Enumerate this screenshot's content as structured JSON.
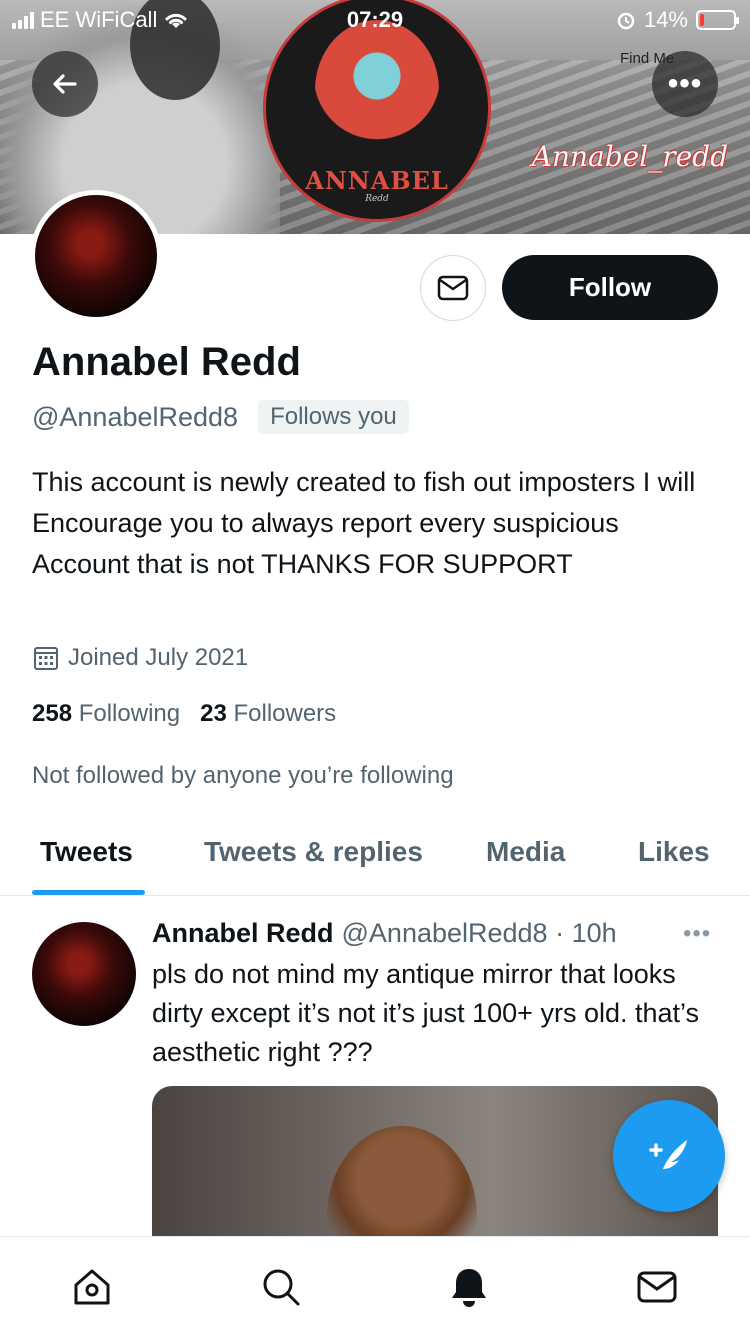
{
  "status_bar": {
    "carrier": "EE WiFiCall",
    "time": "07:29",
    "battery_percent": "14%",
    "battery_level": 0.14,
    "icons": [
      "signal-icon",
      "wifi-icon",
      "alarm-icon",
      "battery-icon"
    ]
  },
  "banner": {
    "logo_text": "ANNABEL",
    "logo_sub": "Redd",
    "script_text": "Annabel_redd",
    "find_me": "Find Me"
  },
  "header": {
    "back_icon": "arrow-left-icon",
    "more_label": "•••"
  },
  "profile": {
    "name": "Annabel Redd",
    "handle": "@AnnabelRedd8",
    "follows_you": "Follows you",
    "bio": "This account is newly created to fish out imposters I will Encourage you to always report every suspicious Account that is not THANKS FOR SUPPORT",
    "joined": "Joined July 2021",
    "following_count": "258",
    "following_label": "Following",
    "followers_count": "23",
    "followers_label": "Followers",
    "not_followed": "Not followed by anyone you’re following"
  },
  "actions": {
    "follow_label": "Follow"
  },
  "tabs": [
    {
      "label": "Tweets",
      "active": true
    },
    {
      "label": "Tweets & replies",
      "active": false
    },
    {
      "label": "Media",
      "active": false
    },
    {
      "label": "Likes",
      "active": false
    }
  ],
  "tweet": {
    "name": "Annabel Redd",
    "meta": "@AnnabelRedd8 · 10h",
    "more": "•••",
    "text": "pls do not mind my antique mirror that looks dirty except it’s not it’s just 100+ yrs old. that’s aesthetic right ???"
  },
  "colors": {
    "accent": "#1d9bf0",
    "text_primary": "#0f1419",
    "text_secondary": "#536471",
    "follow_bg": "#0f1419",
    "battery_low": "#ff3b30"
  },
  "bottom_nav": [
    "home-icon",
    "search-icon",
    "notifications-bell-icon",
    "messages-envelope-icon"
  ]
}
